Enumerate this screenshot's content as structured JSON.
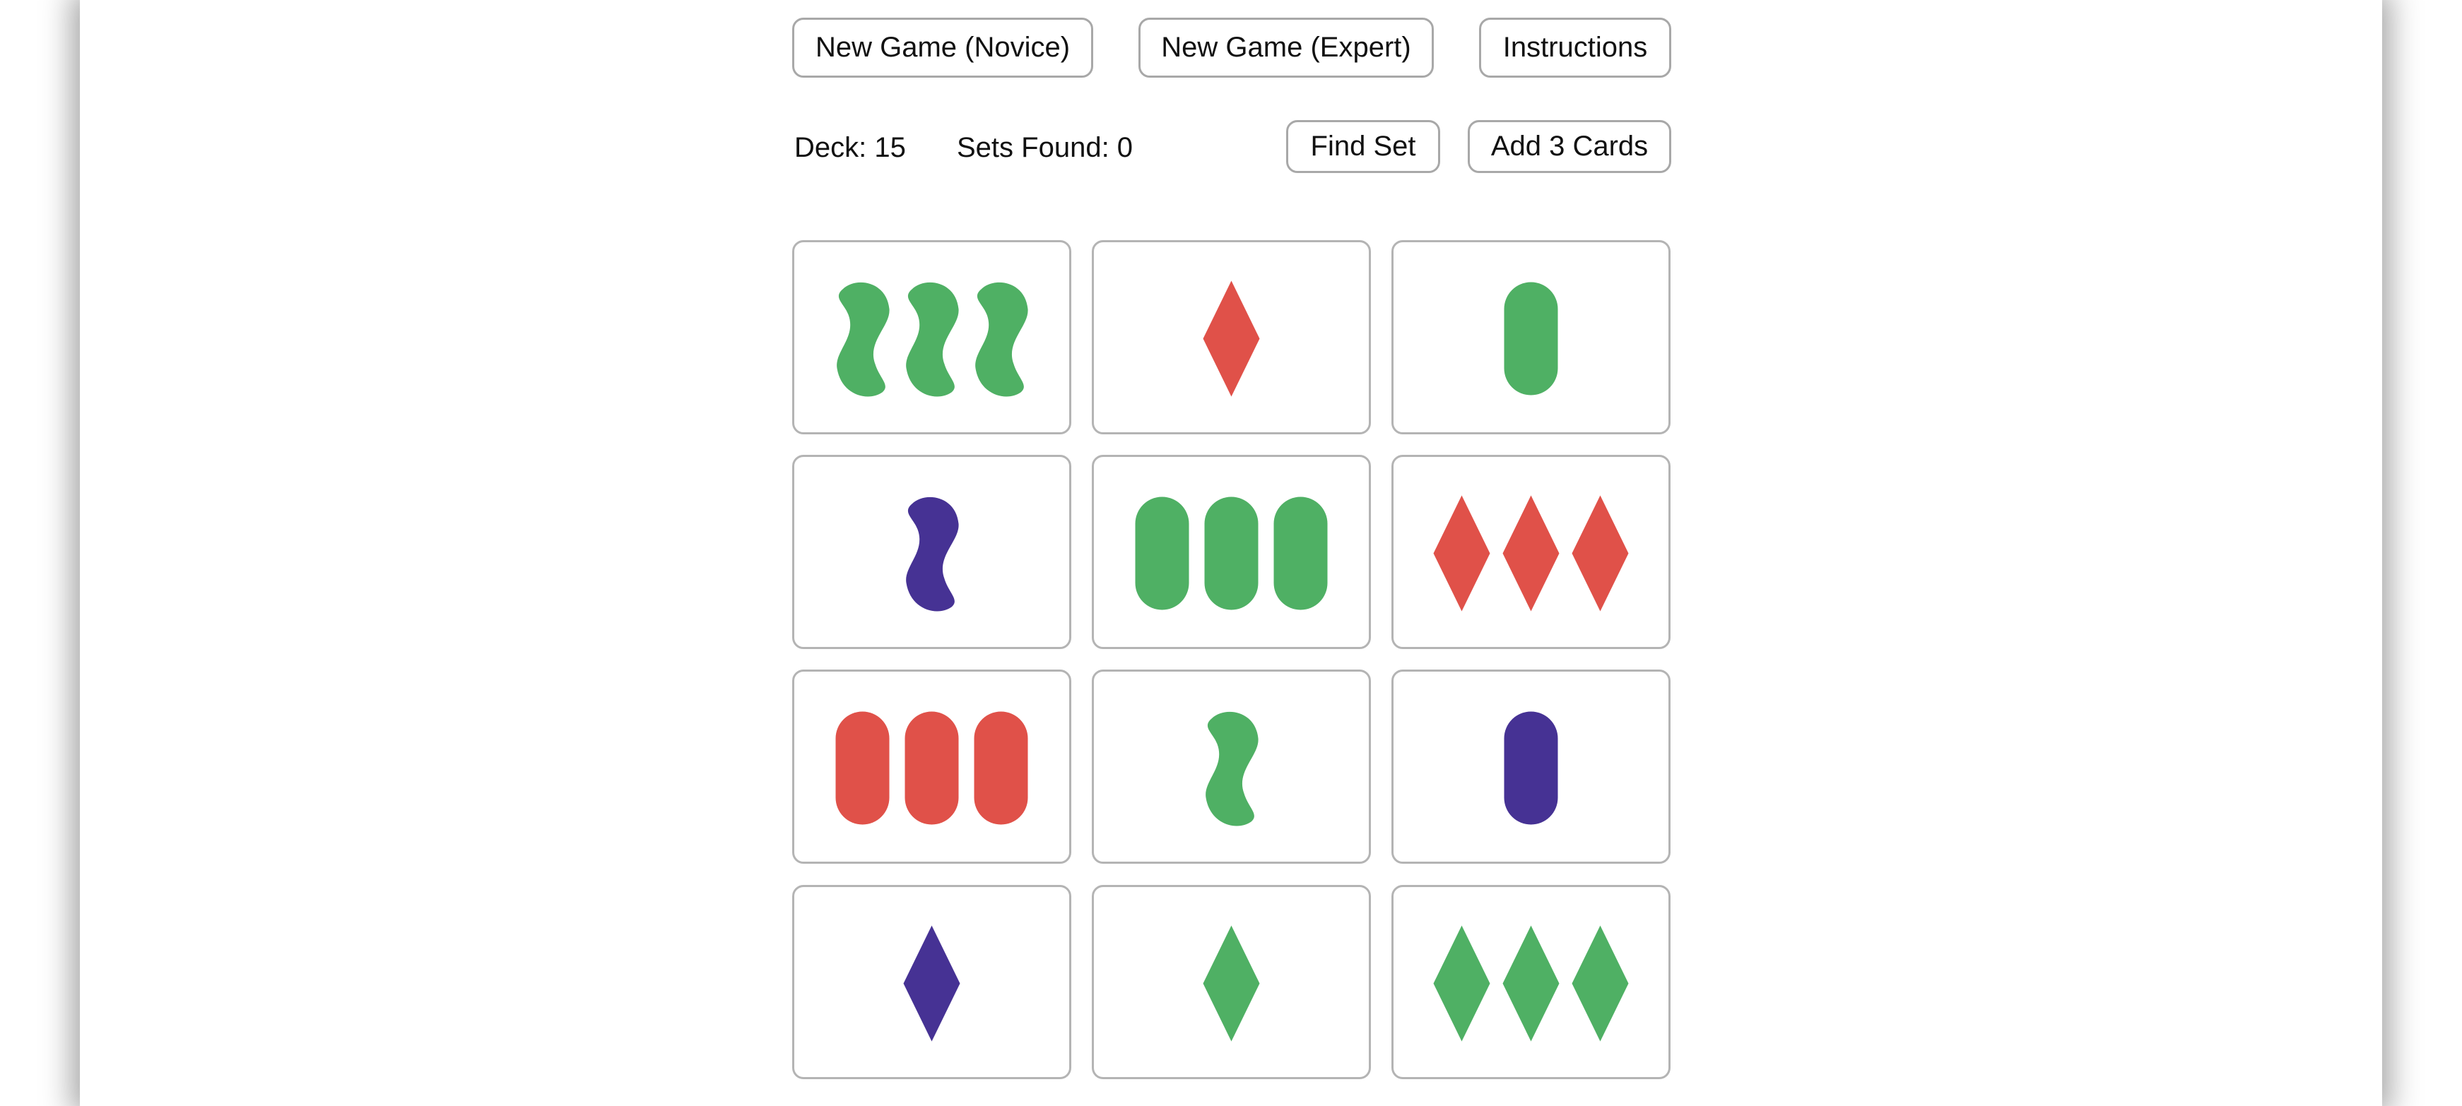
{
  "toolbar": {
    "new_novice_label": "New Game (Novice)",
    "new_expert_label": "New Game (Expert)",
    "instructions_label": "Instructions"
  },
  "status": {
    "deck_text": "Deck: 15",
    "sets_found_text": "Sets Found: 0",
    "find_set_label": "Find Set",
    "add_cards_label": "Add 3 Cards"
  },
  "colors": {
    "green": "#4fb064",
    "red": "#e05149",
    "purple": "#463294"
  },
  "cards": [
    {
      "count": 3,
      "color": "green",
      "shape": "squiggle"
    },
    {
      "count": 1,
      "color": "red",
      "shape": "diamond"
    },
    {
      "count": 1,
      "color": "green",
      "shape": "oval"
    },
    {
      "count": 1,
      "color": "purple",
      "shape": "squiggle"
    },
    {
      "count": 3,
      "color": "green",
      "shape": "oval"
    },
    {
      "count": 3,
      "color": "red",
      "shape": "diamond"
    },
    {
      "count": 3,
      "color": "red",
      "shape": "oval"
    },
    {
      "count": 1,
      "color": "green",
      "shape": "squiggle"
    },
    {
      "count": 1,
      "color": "purple",
      "shape": "oval"
    },
    {
      "count": 1,
      "color": "purple",
      "shape": "diamond"
    },
    {
      "count": 1,
      "color": "green",
      "shape": "diamond"
    },
    {
      "count": 3,
      "color": "green",
      "shape": "diamond"
    }
  ]
}
